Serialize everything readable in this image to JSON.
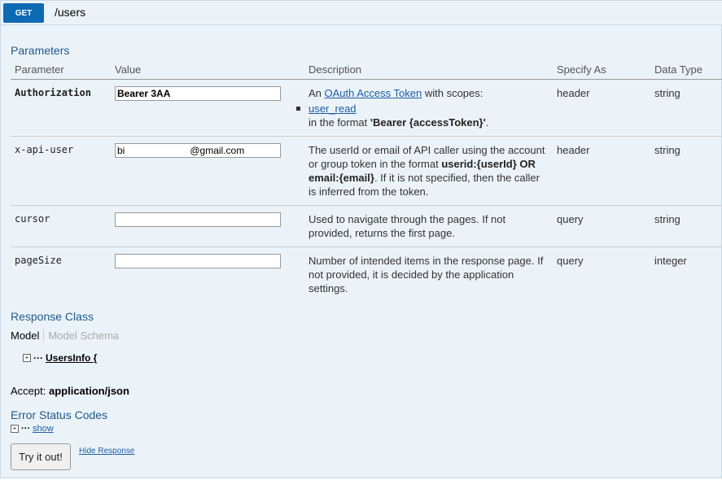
{
  "endpoint": {
    "method": "GET",
    "path": "/users"
  },
  "parameters_title": "Parameters",
  "columns": [
    "Parameter",
    "Value",
    "Description",
    "Specify As",
    "Data Type"
  ],
  "params": [
    {
      "name": "Authorization",
      "value": "Bearer 3AA",
      "desc_prefix": "An ",
      "desc_link": "OAuth Access Token",
      "desc_suffix": " with scopes:",
      "scope": "user_read",
      "format_prefix": "in the format ",
      "format_bold": "'Bearer {accessToken}'",
      "format_suffix": ".",
      "specify_as": "header",
      "data_type": "string"
    },
    {
      "name": "x-api-user",
      "value": "bi                        @gmail.com",
      "desc_1": "The userId or email of API caller using the account or group token in the format ",
      "desc_bold": "userid:{userId} OR email:{email}",
      "desc_2": ". If it is not specified, then the caller is inferred from the token.",
      "specify_as": "header",
      "data_type": "string"
    },
    {
      "name": "cursor",
      "value": "",
      "desc": "Used to navigate through the pages. If not provided, returns the first page.",
      "specify_as": "query",
      "data_type": "string"
    },
    {
      "name": "pageSize",
      "value": "",
      "desc": "Number of intended items in the response page. If not provided, it is decided by the application settings.",
      "specify_as": "query",
      "data_type": "integer"
    }
  ],
  "response_class_title": "Response Class",
  "tabs": {
    "model": "Model",
    "schema": "Model Schema"
  },
  "model_name": "UsersInfo {",
  "accept_label": "Accept:",
  "accept_value": "application/json",
  "error_codes_title": "Error Status Codes",
  "show_label": "show",
  "try_button": "Try it out!",
  "hide_response": "Hide Response",
  "colors": {
    "method": "#0f6ab4",
    "section": "#1e5a8a",
    "panel": "#ebf3f9",
    "link": "#1d5ea8"
  }
}
